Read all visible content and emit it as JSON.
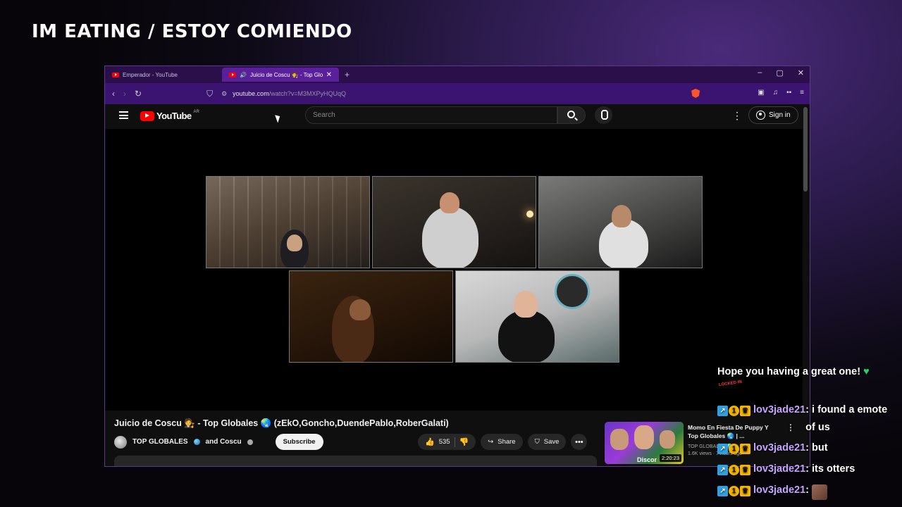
{
  "overlay": {
    "title": "IM EATING / ESTOY COMIENDO"
  },
  "browser": {
    "tabs": [
      {
        "label": "Emperador - YouTube",
        "active": false
      },
      {
        "label": "Juicio de Coscu 🧑‍⚖️ - Top Globales",
        "active": true
      }
    ],
    "url_host": "youtube.com",
    "url_path": "/watch?v=M3MXPyHQUqQ"
  },
  "youtube": {
    "logo_text": "YouTube",
    "country_code": "AR",
    "search_placeholder": "Search",
    "sign_in_label": "Sign in",
    "video": {
      "title": "Juicio de Coscu 🧑‍⚖️ - Top Globales 🌏 (zEkO,Goncho,DuendePablo,RoberGalati)",
      "channel": "TOP GLOBALES",
      "collab": "and Coscu",
      "subscribe_label": "Subscribe",
      "likes": "535",
      "share_label": "Share",
      "save_label": "Save"
    },
    "recommendation": {
      "title": "Momo En Fiesta De Puppy Y Top Globales 🌏 | ...",
      "channel": "TOP GLOBALES 🌏 ✓",
      "views": "1.6K views · 7 hours ago",
      "duration": "2:20:23",
      "thumb_text": "Discor"
    }
  },
  "chat": {
    "first_message": "Hope you having a great one!",
    "locked_badge": "LOCKED IN",
    "messages": [
      {
        "user": "lov3jade21",
        "text": ": i found a emote of us"
      },
      {
        "user": "lov3jade21",
        "text": ": but"
      },
      {
        "user": "lov3jade21",
        "text": ": its otters"
      },
      {
        "user": "lov3jade21",
        "text": ":"
      }
    ]
  },
  "colors": {
    "tabbar": "#2a0f4a",
    "addressbar": "#3a1470",
    "yt_red": "#ff0000",
    "chat_username": "#c6a3ff",
    "heart": "#22d36a"
  }
}
